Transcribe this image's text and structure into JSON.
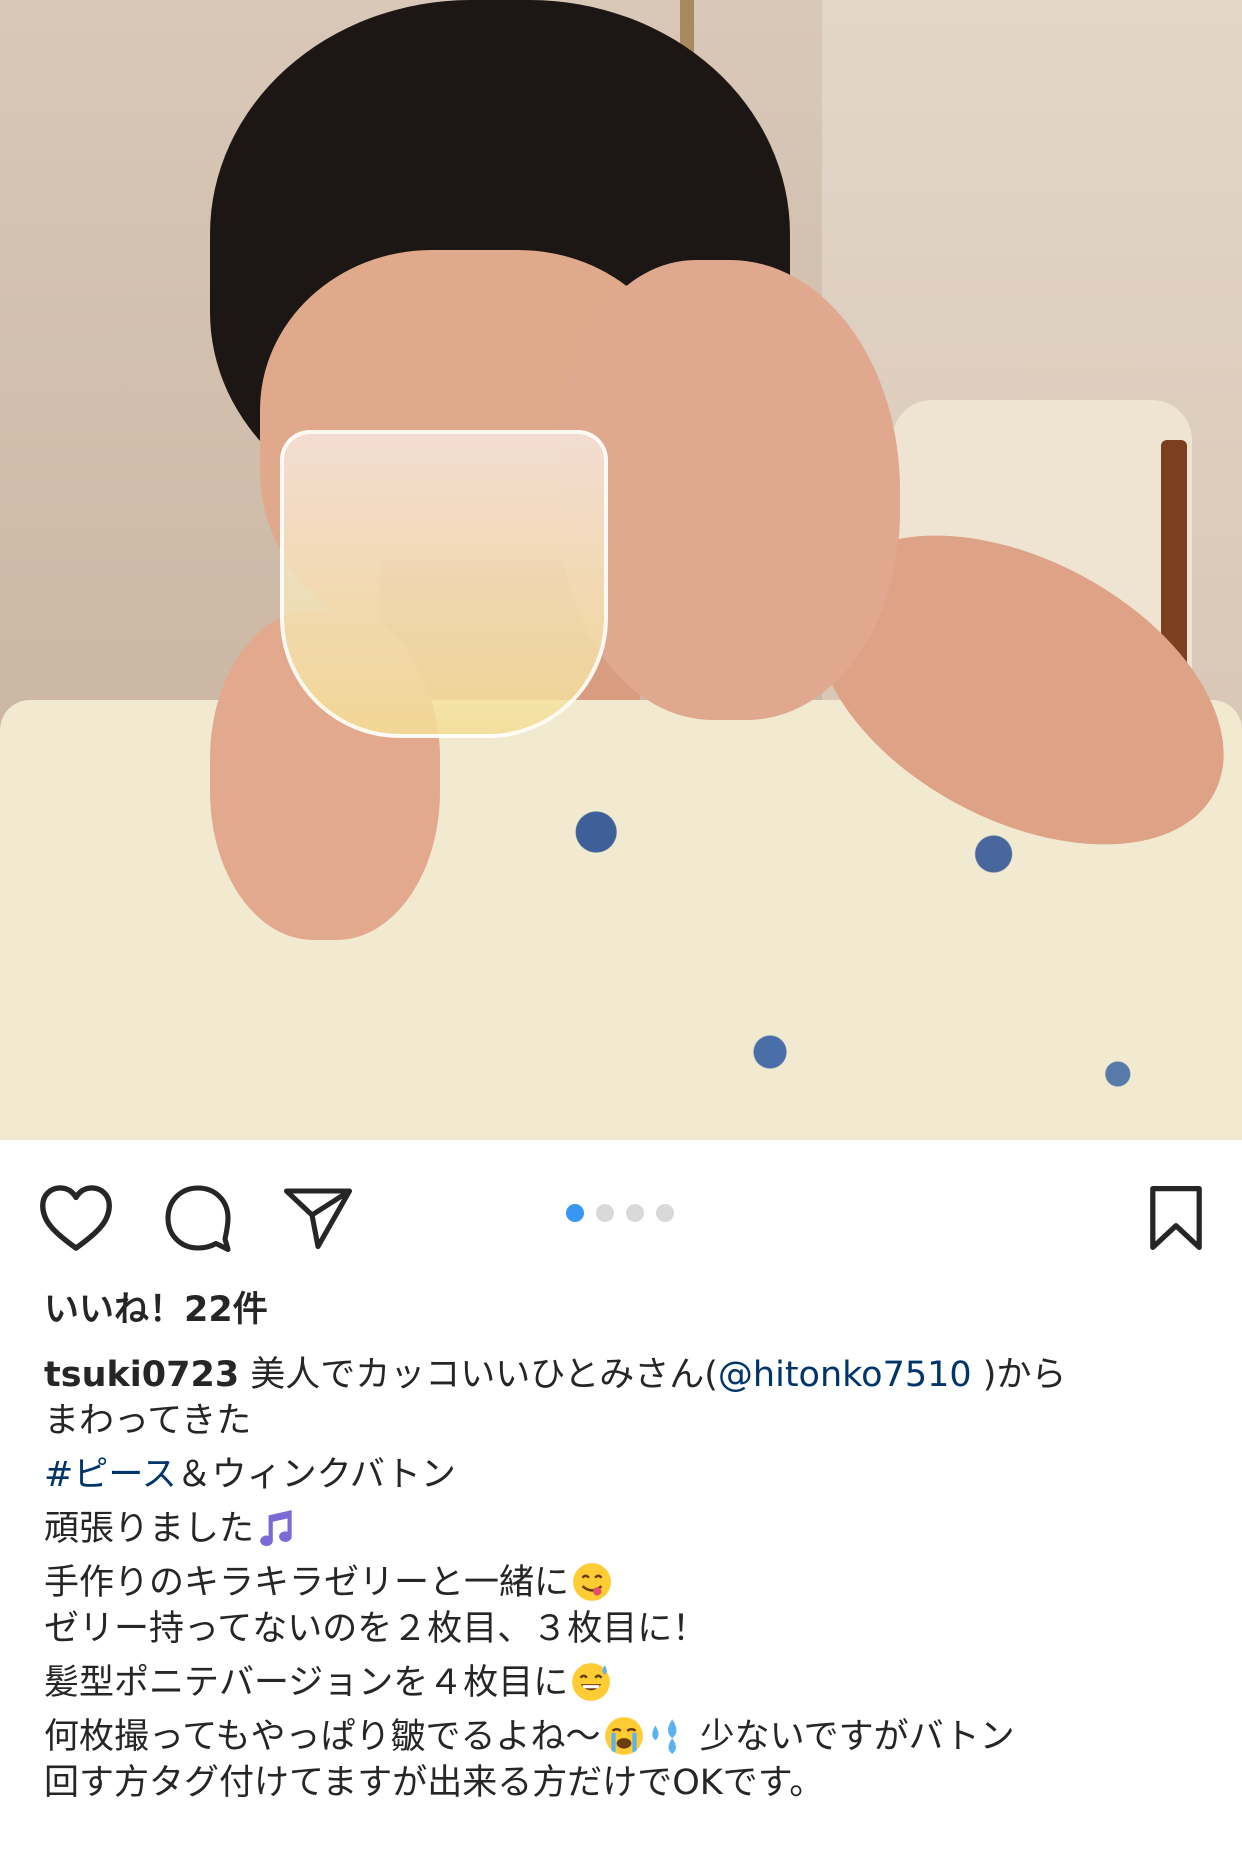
{
  "post": {
    "image_alt": "",
    "carousel": {
      "total": 4,
      "active_index": 0
    }
  },
  "actions": {
    "like_icon": "heart-outline-icon",
    "comment_icon": "speech-bubble-icon",
    "share_icon": "paper-plane-icon",
    "save_icon": "bookmark-outline-icon",
    "accent_color": "#3897f0"
  },
  "likes": {
    "text": "いいね！22件"
  },
  "caption": {
    "username": "tsuki0723",
    "line1_a": " 美人でカッコいいひとみさん(",
    "mention": "@hitonko7510",
    "line1_b": " )から",
    "line2": "まわってきた",
    "hashtag": "#ピース",
    "hashtag_rest": "＆ウィンクバトン",
    "line4": "頑張りました",
    "line5": "手作りのキラキラゼリーと一緒に",
    "line6": "ゼリー持ってないのを２枚目、３枚目に！",
    "line7": "髪型ポニテバージョンを４枚目に",
    "line8_a": "何枚撮ってもやっぱり皺でるよね〜",
    "line8_b": "  少ないですがバトン",
    "line9": "回す方タグ付けてますが出来る方だけでOKです。",
    "emojis": {
      "music": "music-note-emoji",
      "yum": "yummy-face-emoji",
      "sweat_smile": "sweat-smile-emoji",
      "crying": "loudly-crying-emoji",
      "sweat_drops": "sweat-droplets-emoji"
    },
    "link_color": "#003569"
  }
}
